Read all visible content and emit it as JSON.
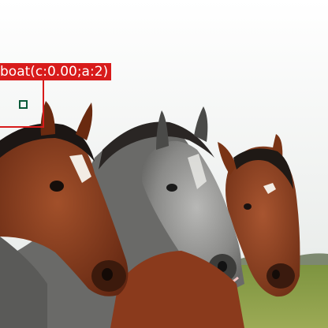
{
  "detection": {
    "label": "boat(c:0.00;a:2)",
    "box_color": "#d81b1b",
    "label_text_color": "#ffffff",
    "point_color": "#0a5c3a"
  },
  "scene": {
    "subject": "three horses",
    "colors": {
      "sky": "#f4f4f4",
      "grass": "#8fa04a",
      "horse_left": "#8b3a1c",
      "horse_middle": "#7c7c7c",
      "horse_right": "#8e3e1e",
      "mane": "#1e1a18"
    }
  }
}
